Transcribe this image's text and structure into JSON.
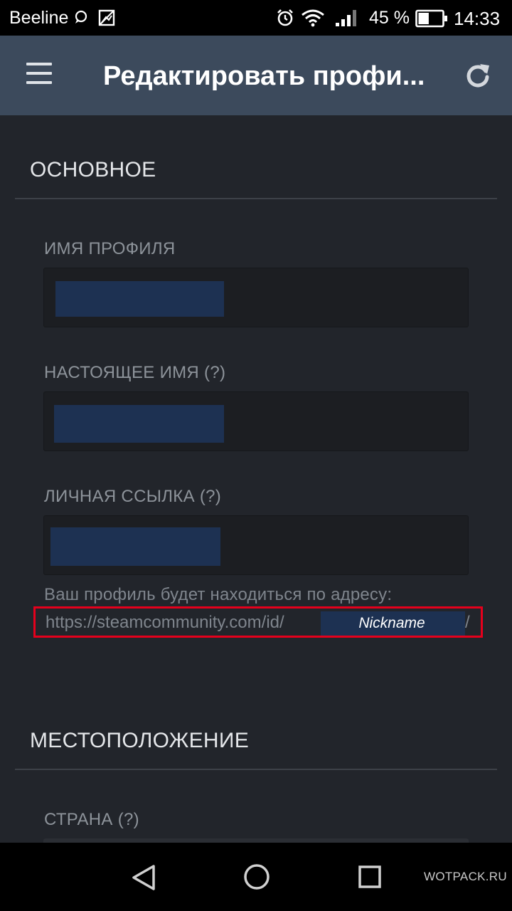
{
  "status_bar": {
    "carrier": "Beeline",
    "icons": [
      "chat-bubble-icon",
      "image-icon",
      "alarm-icon",
      "wifi-icon",
      "signal-icon",
      "battery-icon"
    ],
    "battery": "45 %",
    "battery_level": 0.45,
    "time": "14:33"
  },
  "app_bar": {
    "title": "Редактировать профи...",
    "menu_icon": "hamburger-menu-icon",
    "refresh_icon": "refresh-icon"
  },
  "sections": {
    "basic": {
      "title": "ОСНОВНОЕ",
      "profile_name_label": "ИМЯ ПРОФИЛЯ",
      "real_name_label": "НАСТОЯЩЕЕ ИМЯ (?)",
      "custom_url_label": "ЛИЧНАЯ ССЫЛКА (?)",
      "url_hint": "Ваш профиль будет находиться по адресу:",
      "url_prefix": "https://steamcommunity.com/id/",
      "url_nickname": "Nickname",
      "url_suffix": "/"
    },
    "location": {
      "title": "МЕСТОПОЛОЖЕНИЕ",
      "country_label": "СТРАНА (?)"
    }
  },
  "nav_bar": {
    "icons": [
      "back-triangle-icon",
      "home-circle-icon",
      "recents-square-icon"
    ],
    "watermark": "WOTPACK.RU"
  },
  "colors": {
    "background": "#22252b",
    "app_bar": "#3c4a5c",
    "input": "#1c1e22",
    "highlight_border": "#e5001c",
    "redaction": "#1d3152"
  }
}
